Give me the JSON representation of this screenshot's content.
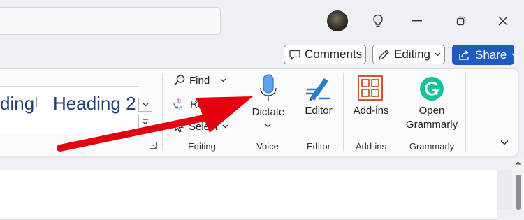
{
  "titlebar": {
    "search_placeholder": "",
    "avatar_alt": "User avatar"
  },
  "header": {
    "comments_label": "Comments",
    "editing_label": "Editing",
    "share_label": "Share"
  },
  "ribbon": {
    "styles": {
      "style_1": "ding",
      "style_2": "Heading 2"
    },
    "editing_group": {
      "find_label": "Find",
      "replace_label": "Repla",
      "select_label": "Select",
      "group_label": "Editing"
    },
    "voice_group": {
      "dictate_label": "Dictate",
      "group_label": "Voice"
    },
    "editor_group": {
      "editor_label": "Editor",
      "group_label": "Editor"
    },
    "addins_group": {
      "addins_label": "Add-ins",
      "group_label": "Add-ins"
    },
    "grammarly_group": {
      "open_label": "Open",
      "grammarly_label": "Grammarly",
      "group_label": "Grammarly"
    }
  },
  "annotation": {
    "arrow_color": "#e3000f"
  },
  "colors": {
    "share_bg": "#1e5bbd",
    "mic_blue": "#2b79d0",
    "addins_orange": "#d2552c",
    "grammarly_green": "#15c39a"
  }
}
